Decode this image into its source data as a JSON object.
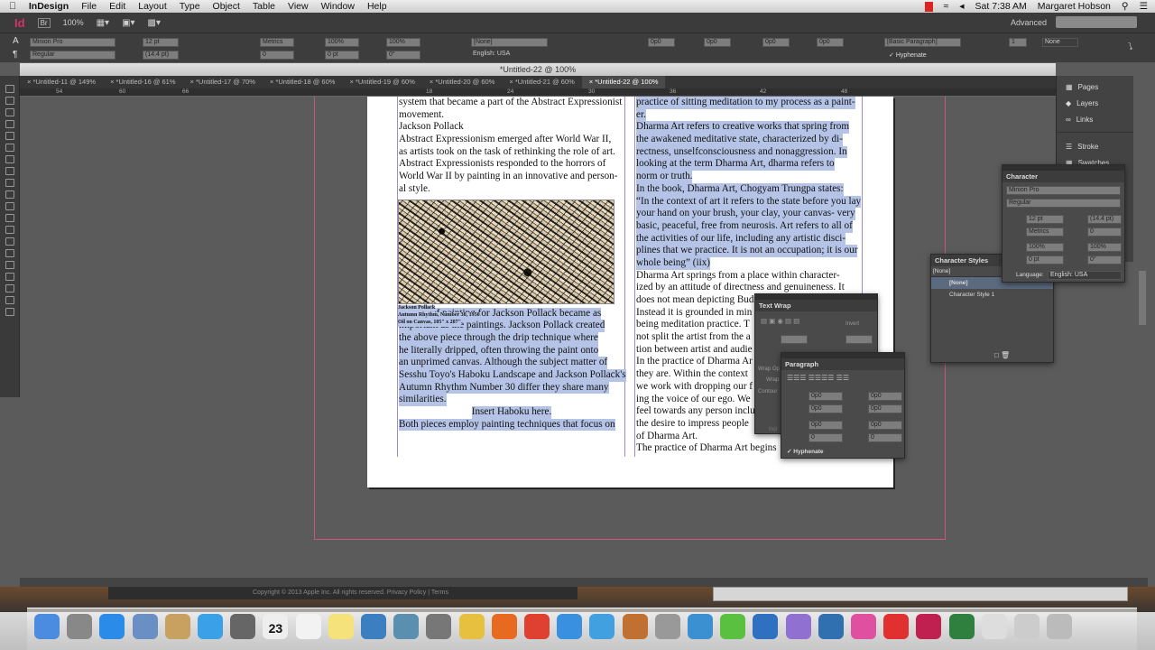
{
  "menubar": {
    "app": "InDesign",
    "items": [
      "File",
      "Edit",
      "Layout",
      "Type",
      "Object",
      "Table",
      "View",
      "Window",
      "Help"
    ],
    "clock": "Sat 7:38 AM",
    "user": "Margaret Hobson"
  },
  "appbar": {
    "logo": "Id",
    "bridge": "Br",
    "zoom": "100%",
    "workspace": "Advanced"
  },
  "control": {
    "font": "Minion Pro",
    "style": "Regular",
    "size": "12 pt",
    "leading": "(14.4 pt)",
    "kerning": "Metrics",
    "tracking": "0",
    "vscale": "100%",
    "hscale": "100%",
    "baseline": "0 pt",
    "skew": "0°",
    "charstyle": "[None]",
    "language": "English: USA",
    "indent": "0p0",
    "parastyle": "[Basic Paragraph]",
    "hyphenate": "Hyphenate",
    "columns": "1",
    "none": "None"
  },
  "document": {
    "title": "*Untitled-22 @ 100%",
    "tabs": [
      "*Untitled-11 @ 149%",
      "*Untitled-16 @ 61%",
      "*Untitled-17 @ 70%",
      "*Untitled-18 @ 60%",
      "*Untitled-19 @ 60%",
      "*Untitled-20 @ 60%",
      "*Untitled-21 @ 60%",
      "*Untitled-22 @ 100%"
    ],
    "ruler": [
      "54",
      "60",
      "66",
      "18",
      "24",
      "30",
      "36",
      "42",
      "48"
    ]
  },
  "left_column": {
    "lines_plain": [
      "system that became a part of the Abstract Expressionist",
      "movement.",
      "Jackson Pollack",
      "Abstract Expressionism emerged after World War II,",
      "as artists took on the task of rethinking the role of art.",
      "Abstract Expressionists responded to the horrors of",
      "World War II by painting in an innovative and person-",
      "al style."
    ],
    "caption": [
      "Jackson Pollack",
      "Autumn Rhythm, Number 30, 1950",
      "Oil on Canvas, 105\" x 207\""
    ],
    "lines_selected": [
      "The act of painting for Jackson Pollack became as",
      "important as the paintings.  Jackson Pollack created",
      "the above piece through the drip technique where",
      "he literally dripped, often throwing the paint onto",
      "an unprimed canvas.  Although the subject matter of",
      "Sesshu Toyo's Haboku Landscape and Jackson Pollack's",
      "Autumn Rhythm Number 30 differ they share many",
      "similarities.",
      "Insert Haboku here.",
      "Both pieces employ painting techniques that focus on"
    ]
  },
  "right_column": {
    "lines_selected": [
      "practice of sitting meditation to my process as a paint-",
      "er.",
      "Dharma Art refers to creative works that spring from",
      "the awakened meditative state, characterized by di-",
      "rectness, unselfconsciousness and nonaggression.  In",
      "looking at the term Dharma Art, dharma refers to",
      "norm or truth.",
      "In the book, Dharma Art, Chogyam Trungpa states:",
      "“In the context of art it refers to the state before you lay",
      "your hand on your brush, your clay, your canvas- very",
      "basic, peaceful, free from neurosis.  Art refers to all of",
      "the activities of our life, including any artistic disci-",
      "plines that we practice.  It is not an occupation; it is our",
      "whole being” (iix)"
    ],
    "lines_plain": [
      "Dharma Art springs from a place within character-",
      "ized by an attitude of directness and genuineness.  It",
      "does not mean depicting Bud",
      "Instead it is grounded in min",
      "being meditation practice.  T",
      "not split the artist from the a",
      "tion between artist and audie",
      "In the practice of Dharma Ar",
      "they are.  Within the context",
      "we work with dropping our f",
      "ing the voice of our ego.   We",
      "feel towards any person inclu",
      "the desire to impress people",
      "of Dharma Art.",
      "The practice of Dharma Art begins"
    ]
  },
  "panels": {
    "dock": [
      "Pages",
      "Layers",
      "Links",
      "Stroke",
      "Swatches"
    ],
    "character": {
      "title": "Character",
      "font": "Minion Pro",
      "style": "Regular",
      "size": "12 pt",
      "leading": "(14.4 pt)",
      "kerning": "Metrics",
      "tracking": "0",
      "vscale": "100%",
      "hscale": "100%",
      "baseline": "0 pt",
      "skew": "0°",
      "language_label": "Language:",
      "language": "English: USA"
    },
    "character_styles": {
      "title": "Character Styles",
      "current": "[None]",
      "items": [
        "[None]",
        "Character Style 1"
      ]
    },
    "text_wrap": {
      "title": "Text Wrap",
      "invert": "Invert",
      "wrap_options": "Wrap Op",
      "wrap": "Wrap",
      "contour": "Contour",
      "incl": "Incl"
    },
    "paragraph": {
      "title": "Paragraph",
      "values": [
        "0p0",
        "0p0",
        "0p0",
        "0p0",
        "0p0",
        "0p0",
        "0",
        "0"
      ],
      "hyphenate": "Hyphenate"
    }
  },
  "footer": {
    "copyright": "Copyright © 2013 Apple Inc. All rights reserved.   Privacy Policy  |  Terms"
  },
  "dock_apps": [
    "Finder",
    "Launchpad",
    "App Store",
    "Preview",
    "Contacts",
    "Messages",
    "FaceTime",
    "Calendar",
    "Reminders",
    "Stickies",
    "Dreamweaver",
    "iPhoto",
    "Image Capture",
    "iMovie",
    "Firefox",
    "Chrome",
    "Safari",
    "iTunes",
    "GarageBand",
    "System Preferences",
    "Word",
    "Muse",
    "Edge Animate",
    "Edge",
    "Thunderbird",
    "Fireworks",
    "Acrobat",
    "InDesign",
    "Numbers",
    "Downloads",
    "Documents",
    "Trash"
  ],
  "calendar_day": "23",
  "colors": {
    "accent": "#d4326b",
    "selection": "#b4c3e6",
    "bleed": "#c9577a",
    "frame": "#a08ac8"
  }
}
